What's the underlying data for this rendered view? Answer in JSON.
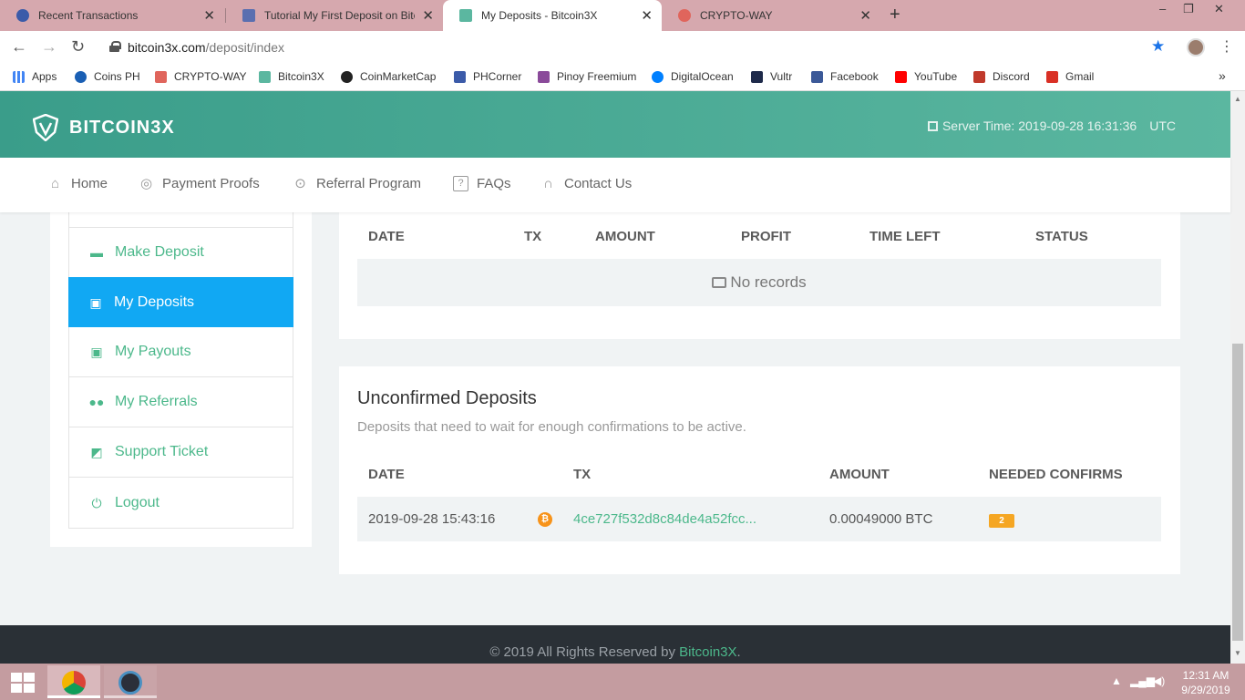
{
  "browser": {
    "tabs": [
      {
        "title": "Recent Transactions",
        "favicon_color": "#3b5ba9",
        "active": false
      },
      {
        "title": "Tutorial My First Deposit on Bitcoin3X",
        "favicon_color": "#5a6fb0",
        "active": false
      },
      {
        "title": "My Deposits - Bitcoin3X",
        "favicon_color": "#5bb7a0",
        "active": true
      },
      {
        "title": "CRYPTO-WAY",
        "favicon_color": "#e0655c",
        "active": false
      }
    ],
    "new_tab": "+",
    "url_host": "bitcoin3x.com",
    "url_path": "/deposit/index",
    "window_controls": {
      "minimize": "–",
      "restore": "❐",
      "close": "✕"
    },
    "bookmarks": [
      {
        "label": "Apps",
        "color": "#4285f4"
      },
      {
        "label": "Coins PH",
        "color": "#1a5fb4"
      },
      {
        "label": "CRYPTO-WAY",
        "color": "#e0655c"
      },
      {
        "label": "Bitcoin3X",
        "color": "#5bb7a0"
      },
      {
        "label": "CoinMarketCap",
        "color": "#222222"
      },
      {
        "label": "PHCorner",
        "color": "#3b5ba9"
      },
      {
        "label": "Pinoy Freemium",
        "color": "#8a4a9a"
      },
      {
        "label": "DigitalOcean",
        "color": "#0080ff"
      },
      {
        "label": "Vultr",
        "color": "#1e2a4a"
      },
      {
        "label": "Facebook",
        "color": "#3b5998"
      },
      {
        "label": "YouTube",
        "color": "#ff0000"
      },
      {
        "label": "Discord",
        "color": "#c0392b"
      },
      {
        "label": "Gmail",
        "color": "#d93025"
      }
    ],
    "bookmarks_more": "»"
  },
  "header": {
    "logo_text": "BITCOIN3X",
    "server_time": "Server Time: 2019-09-28 16:31:36",
    "timezone": "UTC",
    "nav": [
      {
        "label": "Home",
        "icon": "home-icon"
      },
      {
        "label": "Payment Proofs",
        "icon": "target-icon"
      },
      {
        "label": "Referral Program",
        "icon": "dollar-circle-icon"
      },
      {
        "label": "FAQs",
        "icon": "question-icon"
      },
      {
        "label": "Contact Us",
        "icon": "headset-icon"
      }
    ]
  },
  "sidebar": {
    "items": [
      {
        "label": "Make Deposit",
        "icon": "make-deposit-icon",
        "active": false
      },
      {
        "label": "My Deposits",
        "icon": "my-deposits-icon",
        "active": true
      },
      {
        "label": "My Payouts",
        "icon": "my-payouts-icon",
        "active": false
      },
      {
        "label": "My Referrals",
        "icon": "users-icon",
        "active": false
      },
      {
        "label": "Support Ticket",
        "icon": "ticket-icon",
        "active": false
      },
      {
        "label": "Logout",
        "icon": "power-icon",
        "active": false
      }
    ]
  },
  "deposits_table": {
    "columns": [
      "DATE",
      "TX",
      "AMOUNT",
      "PROFIT",
      "TIME LEFT",
      "STATUS"
    ],
    "empty_text": "No records"
  },
  "unconfirmed": {
    "title": "Unconfirmed Deposits",
    "subtitle": "Deposits that need to wait for enough confirmations to be active.",
    "columns": [
      "DATE",
      "TX",
      "AMOUNT",
      "NEEDED CONFIRMS"
    ],
    "rows": [
      {
        "date": "2019-09-28 15:43:16",
        "coin_icon": "bitcoin-icon",
        "coin_glyph": "₿",
        "tx": "4ce727f532d8c84de4a52fcc...",
        "amount": "0.00049000 BTC",
        "needed_confirms": "2"
      }
    ]
  },
  "footer": {
    "prefix": "© 2019 All Rights Reserved by ",
    "brand": "Bitcoin3X",
    "suffix": "."
  },
  "taskbar": {
    "clock_time": "12:31 AM",
    "clock_date": "9/29/2019"
  },
  "colors": {
    "header_start": "#3a9d8a",
    "header_end": "#5bb7a0",
    "accent_green": "#4cb88b",
    "active_blue": "#11a8f3",
    "badge_orange": "#f5a623",
    "footer_bg": "#2a3036"
  }
}
